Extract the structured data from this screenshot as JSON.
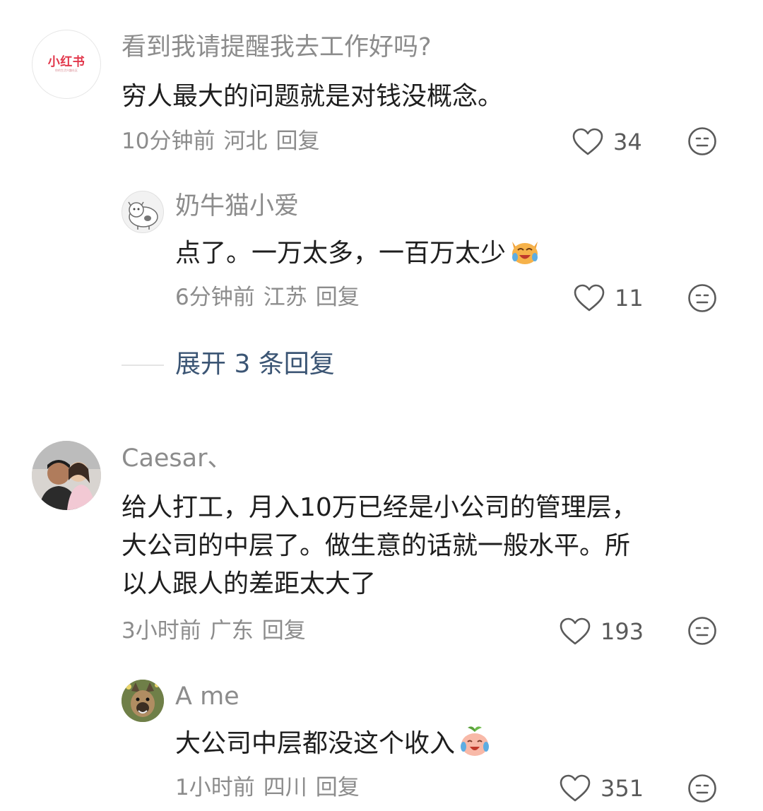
{
  "comments": [
    {
      "username": "看到我请提醒我去工作好吗?",
      "avatar_logo_text": "小红书",
      "avatar_logo_sub": "你的生活兴趣社区",
      "text": "穷人最大的问题就是对钱没概念。",
      "time": "10分钟前",
      "location": "河北",
      "reply_label": "回复",
      "likes": "34",
      "replies": [
        {
          "username": "奶牛猫小爱",
          "text": "点了。一万太多，一百万太少",
          "emoji": "crying-laughing-cat-emoji",
          "time": "6分钟前",
          "location": "江苏",
          "reply_label": "回复",
          "likes": "11"
        }
      ],
      "expand_label": "展开 3 条回复"
    },
    {
      "username": "Caesar、",
      "text_lines": [
        "给人打工，月入10万已经是小公司的管理层，",
        "大公司的中层了。做生意的话就一般水平。所",
        "以人跟人的差距太大了"
      ],
      "time": "3小时前",
      "location": "广东",
      "reply_label": "回复",
      "likes": "193",
      "replies": [
        {
          "username": "A me",
          "text": "大公司中层都没这个收入",
          "emoji": "crying-peach-emoji",
          "time": "1小时前",
          "location": "四川",
          "reply_label": "回复",
          "likes": "351"
        }
      ]
    }
  ],
  "icons": {
    "like": "heart-outline-icon",
    "dislike": "meh-face-icon"
  },
  "colors": {
    "brand": "#e2364a",
    "username": "#8c8c8c",
    "text": "#1e1e1e",
    "meta": "#8c8c8c",
    "expand": "#3b5574",
    "icon": "#5a5a5a"
  }
}
